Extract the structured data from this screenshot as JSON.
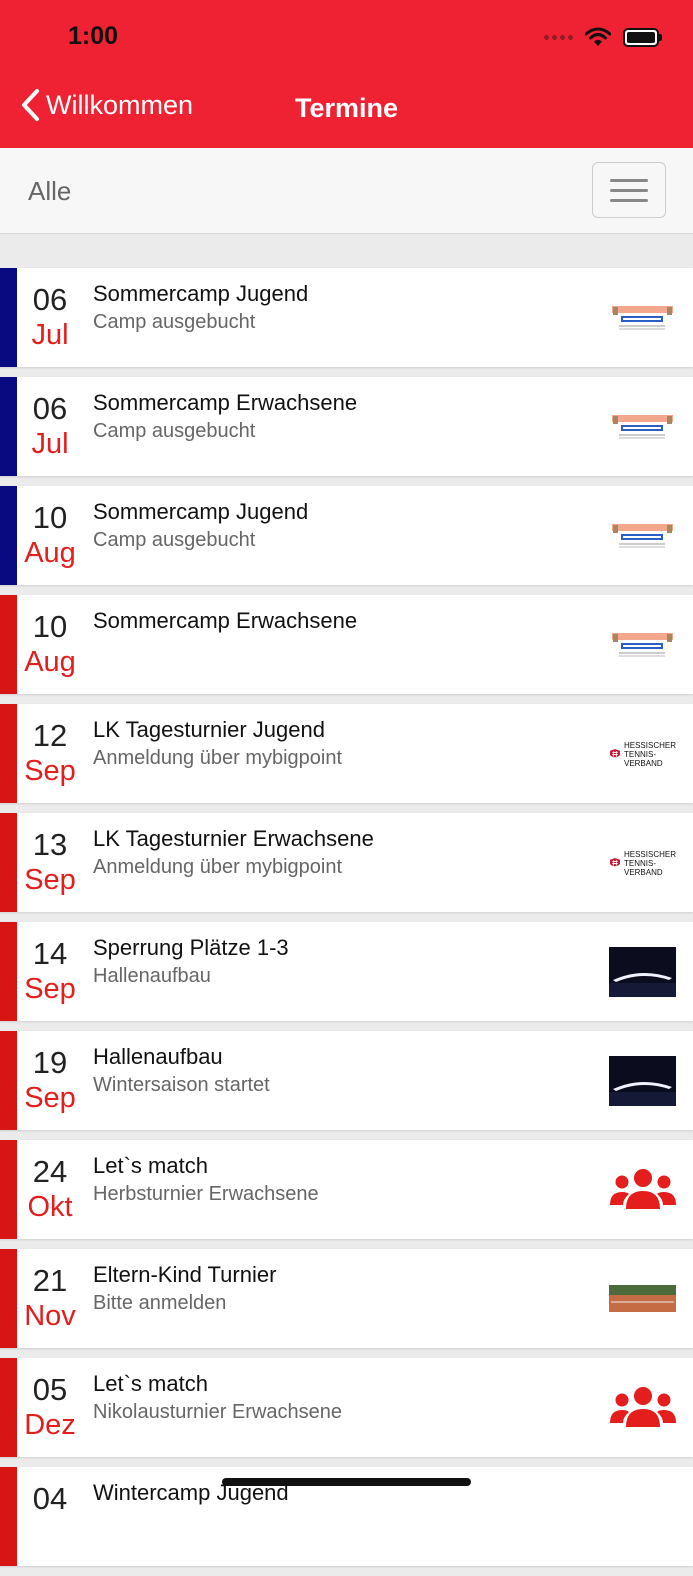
{
  "status_bar": {
    "time": "1:00"
  },
  "nav": {
    "back_label": "Willkommen",
    "title": "Termine"
  },
  "filter": {
    "label": "Alle"
  },
  "colors": {
    "header": "#ee2233",
    "bar_blue": "#0a0a80",
    "bar_red": "#d81515",
    "month_red": "#e41d1d"
  },
  "events": [
    {
      "day": "06",
      "month": "Jul",
      "title": "Sommercamp Jugend",
      "subtitle": "Camp ausgebucht",
      "bar": "blue",
      "icon": "tenniscamp-flyer-icon"
    },
    {
      "day": "06",
      "month": "Jul",
      "title": "Sommercamp Erwachsene",
      "subtitle": "Camp ausgebucht",
      "bar": "blue",
      "icon": "tenniscamp-flyer-icon"
    },
    {
      "day": "10",
      "month": "Aug",
      "title": "Sommercamp Jugend",
      "subtitle": "Camp ausgebucht",
      "bar": "blue",
      "icon": "tenniscamp-flyer-icon"
    },
    {
      "day": "10",
      "month": "Aug",
      "title": "Sommercamp Erwachsene",
      "subtitle": "",
      "bar": "red",
      "icon": "tenniscamp-flyer-icon"
    },
    {
      "day": "12",
      "month": "Sep",
      "title": "LK Tagesturnier Jugend",
      "subtitle": "Anmeldung über mybigpoint",
      "bar": "red",
      "icon": "htv-logo-icon",
      "logo_text": [
        "Hessischer",
        "Tennis-",
        "Verband"
      ]
    },
    {
      "day": "13",
      "month": "Sep",
      "title": "LK Tagesturnier Erwachsene",
      "subtitle": "Anmeldung über mybigpoint",
      "bar": "red",
      "icon": "htv-logo-icon",
      "logo_text": [
        "Hessischer",
        "Tennis-",
        "Verband"
      ]
    },
    {
      "day": "14",
      "month": "Sep",
      "title": "Sperrung Plätze 1-3",
      "subtitle": "Hallenaufbau",
      "bar": "red",
      "icon": "tennis-hall-night-icon"
    },
    {
      "day": "19",
      "month": "Sep",
      "title": "Hallenaufbau",
      "subtitle": "Wintersaison startet",
      "bar": "red",
      "icon": "tennis-hall-night-icon"
    },
    {
      "day": "24",
      "month": "Okt",
      "title": "Let`s match",
      "subtitle": "Herbsturnier Erwachsene",
      "bar": "red",
      "icon": "users-group-icon"
    },
    {
      "day": "21",
      "month": "Nov",
      "title": "Eltern-Kind Turnier",
      "subtitle": "Bitte anmelden",
      "bar": "red",
      "icon": "clay-court-photo-icon"
    },
    {
      "day": "05",
      "month": "Dez",
      "title": "Let`s match",
      "subtitle": "Nikolausturnier Erwachsene",
      "bar": "red",
      "icon": "users-group-icon"
    },
    {
      "day": "04",
      "month": "",
      "title": "Wintercamp Jugend",
      "subtitle": "",
      "bar": "red",
      "icon": ""
    }
  ]
}
